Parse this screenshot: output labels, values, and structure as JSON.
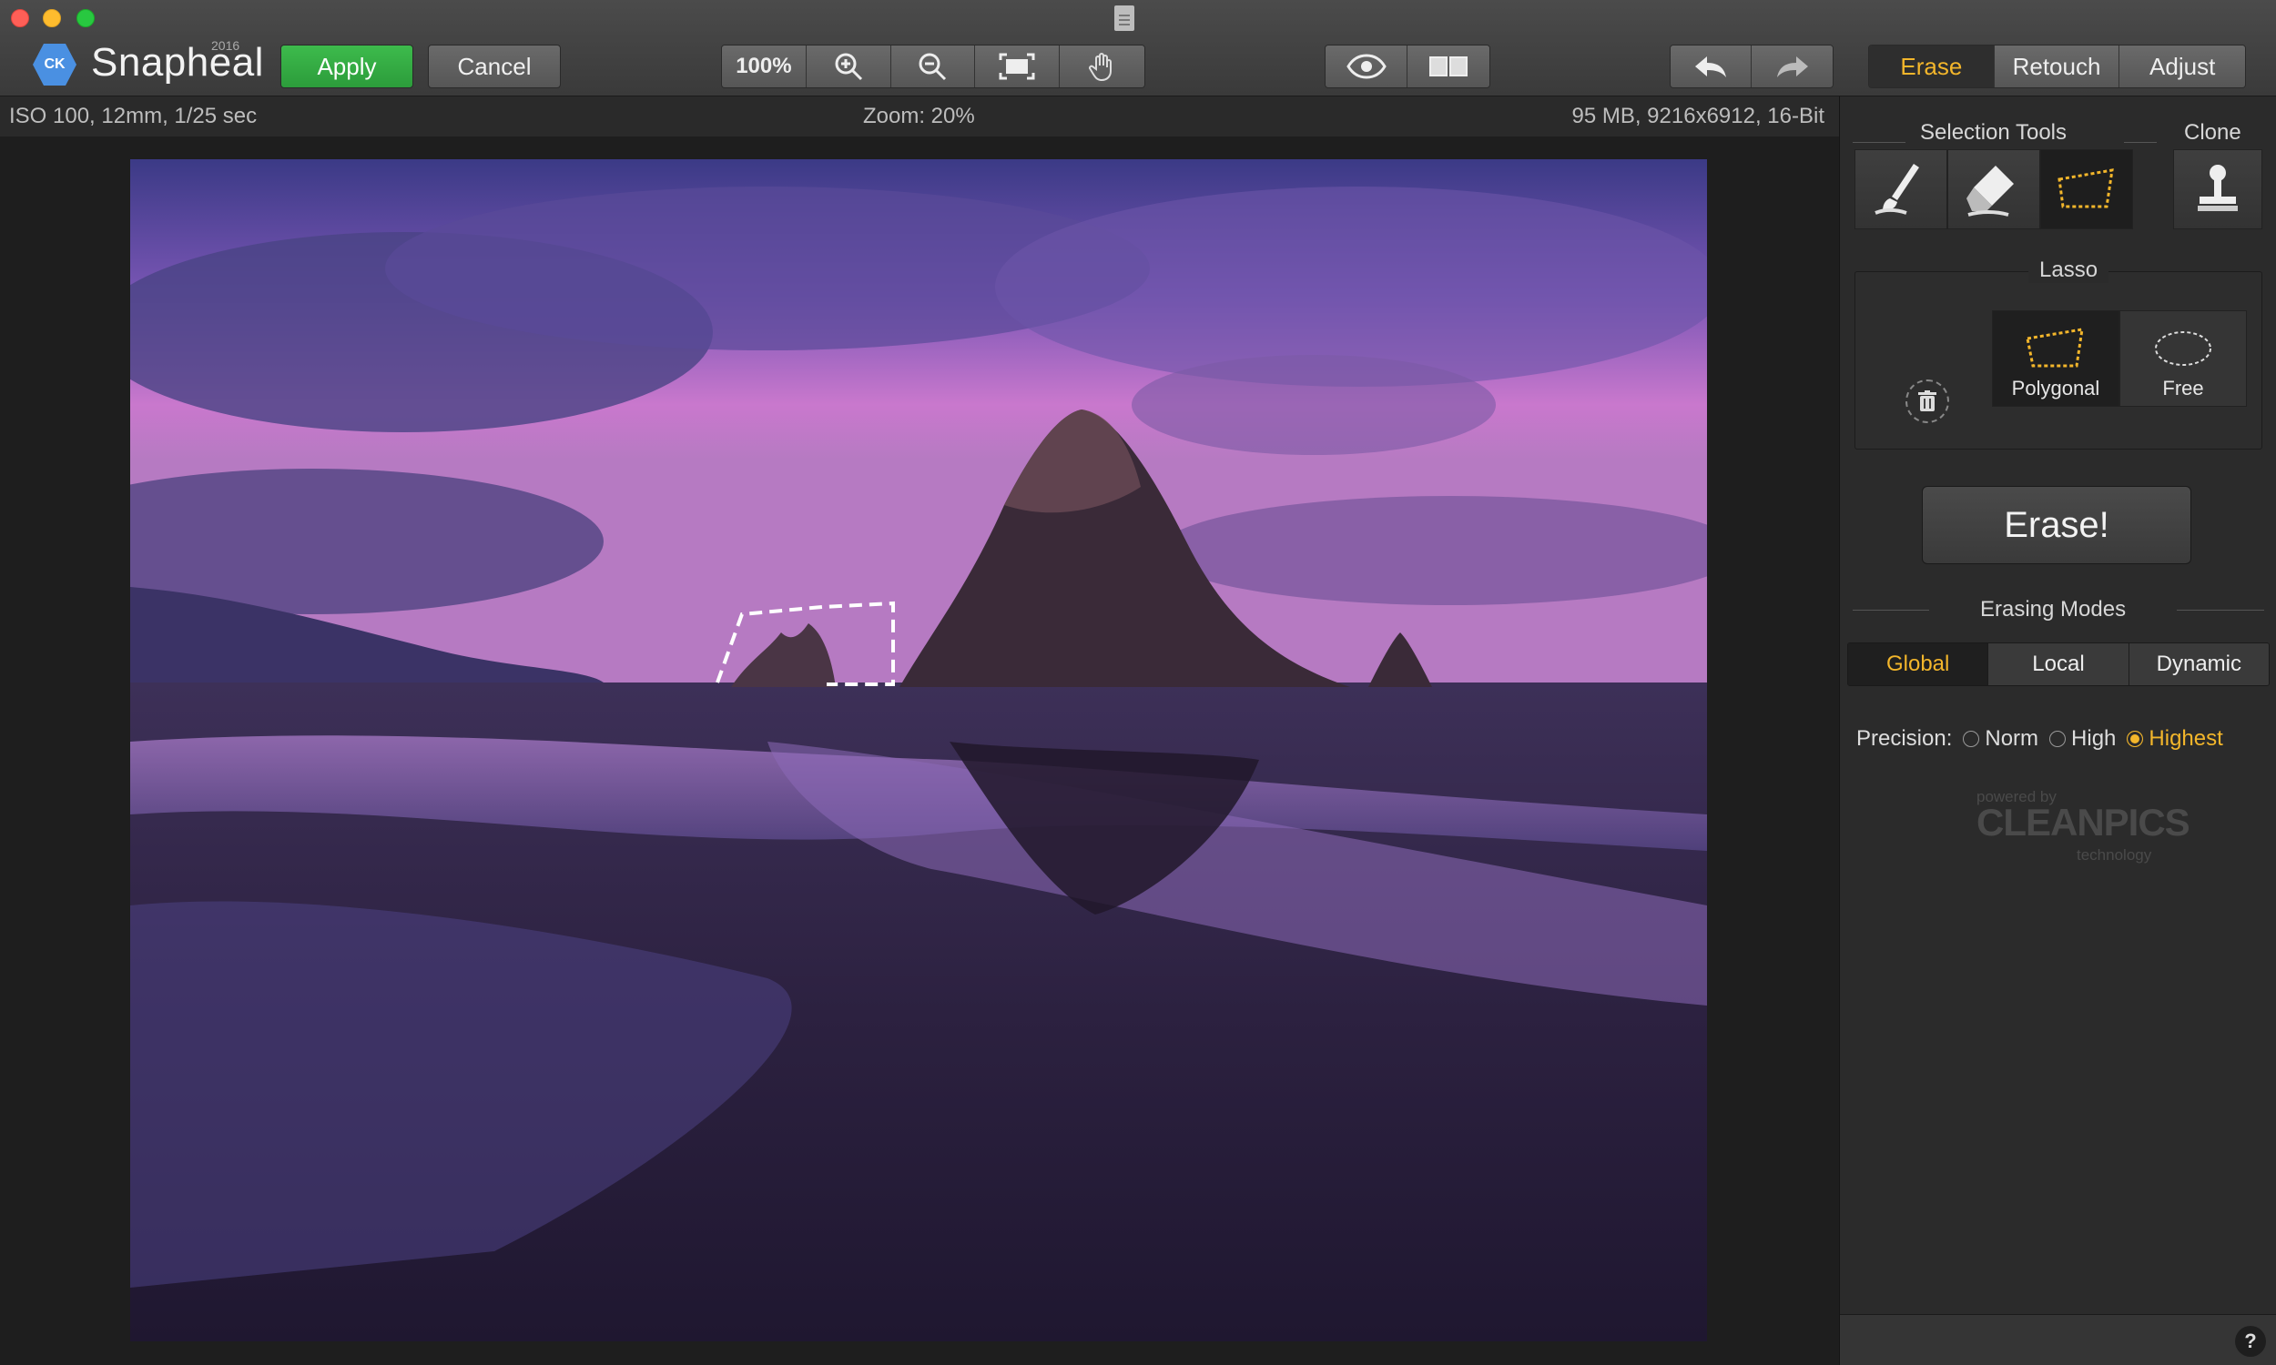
{
  "app": {
    "name": "Snapheal",
    "year": "2016",
    "logo_text": "CK"
  },
  "toolbar": {
    "apply_label": "Apply",
    "cancel_label": "Cancel",
    "zoom_100_label": "100%",
    "modes": [
      "Erase",
      "Retouch",
      "Adjust"
    ],
    "active_mode": "Erase"
  },
  "infobar": {
    "exif": "ISO 100, 12mm, 1/25 sec",
    "zoom": "Zoom: 20%",
    "file_info": "95 MB, 9216x6912, 16-Bit"
  },
  "panel": {
    "selection_tools_title": "Selection Tools",
    "clone_title": "Clone",
    "lasso_title": "Lasso",
    "lasso_options": [
      "Polygonal",
      "Free"
    ],
    "active_lasso": "Polygonal",
    "erase_button_label": "Erase!",
    "erasing_modes_title": "Erasing Modes",
    "erasing_modes": [
      "Global",
      "Local",
      "Dynamic"
    ],
    "active_erasing_mode": "Global",
    "precision_label": "Precision:",
    "precision_options": [
      "Norm",
      "High",
      "Highest"
    ],
    "active_precision": "Highest",
    "powered_by": {
      "line1": "powered by",
      "line2": "CLEANPICS",
      "line3": "technology"
    },
    "help_label": "?"
  },
  "colors": {
    "accent": "#f3b62b",
    "apply_green": "#34a846",
    "logo_blue": "#4a90e2"
  }
}
